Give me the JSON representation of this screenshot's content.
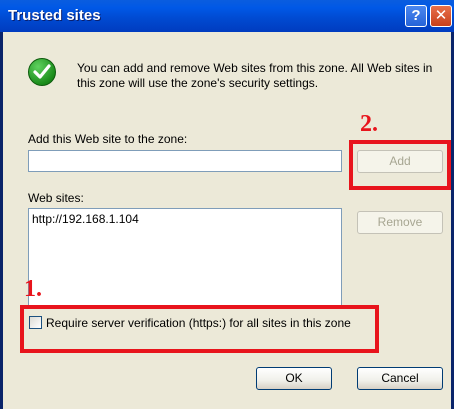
{
  "window": {
    "title": "Trusted sites"
  },
  "info": {
    "text": "You can add and remove Web sites from this zone. All Web sites in this zone will use the zone's security settings."
  },
  "add_site": {
    "label": "Add this Web site to the zone:",
    "value": "",
    "add_button": "Add"
  },
  "web_sites": {
    "label": "Web sites:",
    "items": [
      "http://192.168.1.104"
    ],
    "remove_button": "Remove"
  },
  "require_verification": {
    "label": "Require server verification (https:) for all sites in this zone",
    "checked": false
  },
  "footer": {
    "ok": "OK",
    "cancel": "Cancel"
  },
  "annotations": {
    "step1": "1.",
    "step2": "2.",
    "color": "#e8141c"
  },
  "colors": {
    "titlebar": "#0058e6",
    "client": "#ece9d8"
  }
}
